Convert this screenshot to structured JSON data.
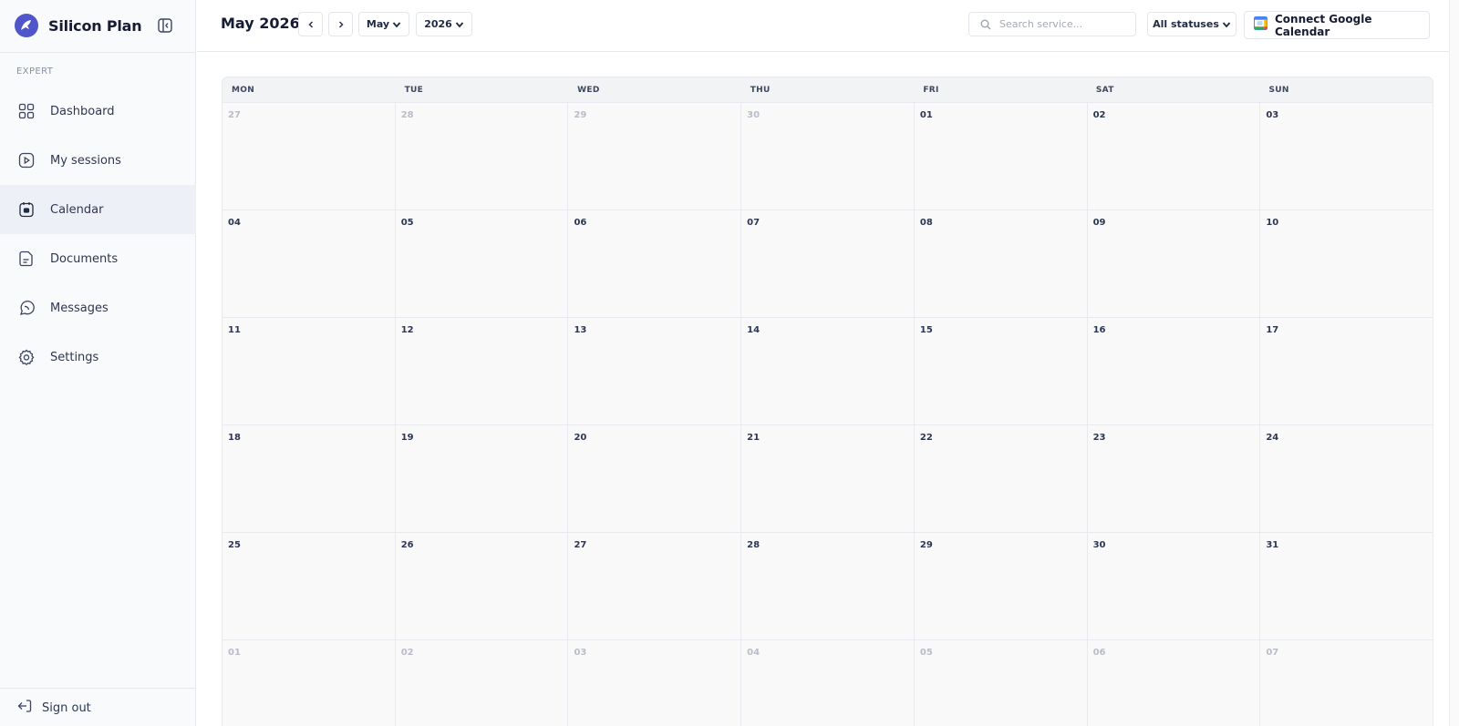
{
  "brand": {
    "name": "Silicon Plan",
    "accent": "#4e56c9"
  },
  "sidebar": {
    "section_label": "EXPERT",
    "items": [
      {
        "label": "Dashboard",
        "icon": "grid-icon",
        "active": false
      },
      {
        "label": "My sessions",
        "icon": "play-icon",
        "active": false
      },
      {
        "label": "Calendar",
        "icon": "calendar-icon",
        "active": true
      },
      {
        "label": "Documents",
        "icon": "document-icon",
        "active": false
      },
      {
        "label": "Messages",
        "icon": "chat-icon",
        "active": false
      },
      {
        "label": "Settings",
        "icon": "gear-icon",
        "active": false
      }
    ],
    "sign_out_label": "Sign out"
  },
  "header": {
    "title": "May 2026",
    "month_select": "May",
    "year_select": "2026",
    "search_placeholder": "Search service...",
    "status_filter": "All statuses",
    "connect_label": "Connect Google Calendar"
  },
  "calendar": {
    "weekdays": [
      "MON",
      "TUE",
      "WED",
      "THU",
      "FRI",
      "SAT",
      "SUN"
    ],
    "weeks": [
      [
        {
          "day": "27",
          "muted": true
        },
        {
          "day": "28",
          "muted": true
        },
        {
          "day": "29",
          "muted": true
        },
        {
          "day": "30",
          "muted": true
        },
        {
          "day": "01",
          "muted": false
        },
        {
          "day": "02",
          "muted": false
        },
        {
          "day": "03",
          "muted": false
        }
      ],
      [
        {
          "day": "04",
          "muted": false
        },
        {
          "day": "05",
          "muted": false
        },
        {
          "day": "06",
          "muted": false
        },
        {
          "day": "07",
          "muted": false
        },
        {
          "day": "08",
          "muted": false
        },
        {
          "day": "09",
          "muted": false
        },
        {
          "day": "10",
          "muted": false
        }
      ],
      [
        {
          "day": "11",
          "muted": false
        },
        {
          "day": "12",
          "muted": false
        },
        {
          "day": "13",
          "muted": false
        },
        {
          "day": "14",
          "muted": false
        },
        {
          "day": "15",
          "muted": false
        },
        {
          "day": "16",
          "muted": false
        },
        {
          "day": "17",
          "muted": false
        }
      ],
      [
        {
          "day": "18",
          "muted": false
        },
        {
          "day": "19",
          "muted": false
        },
        {
          "day": "20",
          "muted": false
        },
        {
          "day": "21",
          "muted": false
        },
        {
          "day": "22",
          "muted": false
        },
        {
          "day": "23",
          "muted": false
        },
        {
          "day": "24",
          "muted": false
        }
      ],
      [
        {
          "day": "25",
          "muted": false
        },
        {
          "day": "26",
          "muted": false
        },
        {
          "day": "27",
          "muted": false
        },
        {
          "day": "28",
          "muted": false
        },
        {
          "day": "29",
          "muted": false
        },
        {
          "day": "30",
          "muted": false
        },
        {
          "day": "31",
          "muted": false
        }
      ],
      [
        {
          "day": "01",
          "muted": true
        },
        {
          "day": "02",
          "muted": true
        },
        {
          "day": "03",
          "muted": true
        },
        {
          "day": "04",
          "muted": true
        },
        {
          "day": "05",
          "muted": true
        },
        {
          "day": "06",
          "muted": true
        },
        {
          "day": "07",
          "muted": true
        }
      ]
    ]
  }
}
